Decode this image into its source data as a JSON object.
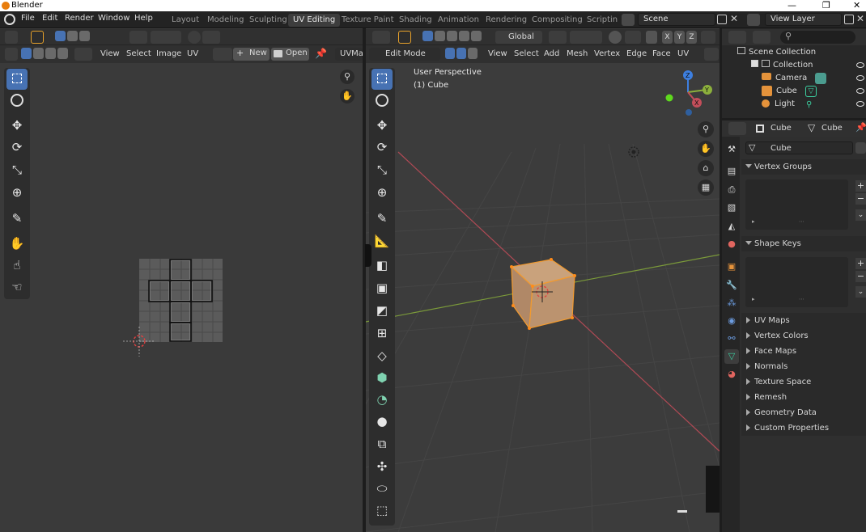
{
  "window": {
    "title": "Blender",
    "controls": [
      "—",
      "❐",
      "✕"
    ]
  },
  "menubar": {
    "items": [
      "File",
      "Edit",
      "Render",
      "Window",
      "Help"
    ]
  },
  "workspaces": {
    "tabs": [
      "Layout",
      "Modeling",
      "Sculpting",
      "UV Editing",
      "Texture Paint",
      "Shading",
      "Animation",
      "Rendering",
      "Compositing",
      "Scriptin"
    ],
    "active": "UV Editing"
  },
  "scene": {
    "name": "Scene"
  },
  "view_layer": {
    "name": "View Layer"
  },
  "uv_editor": {
    "menus": [
      "View",
      "Select",
      "Image",
      "UV"
    ],
    "new_label": "New",
    "open_label": "Open",
    "uvmap_label": "UVMap"
  },
  "viewport": {
    "orientation": "Global",
    "mode": "Edit Mode",
    "menus": [
      "View",
      "Select",
      "Add",
      "Mesh",
      "Vertex",
      "Edge",
      "Face",
      "UV"
    ],
    "info_line1": "User Perspective",
    "info_line2": "(1) Cube",
    "axis_letters": [
      "X",
      "Y",
      "Z"
    ],
    "gizmo_labels": {
      "x": "X",
      "y": "Y",
      "z": "Z"
    }
  },
  "outliner": {
    "root": "Scene Collection",
    "collection": "Collection",
    "objects": [
      "Camera",
      "Cube",
      "Light"
    ]
  },
  "properties": {
    "object_name": "Cube",
    "mesh_name": "Cube",
    "data_field": "Cube",
    "open_panels": [
      "Vertex Groups",
      "Shape Keys"
    ],
    "closed_panels": [
      "UV Maps",
      "Vertex Colors",
      "Face Maps",
      "Normals",
      "Texture Space",
      "Remesh",
      "Geometry Data",
      "Custom Properties"
    ]
  },
  "colors": {
    "accent": "#4772b3",
    "x_axis": "#c34e5a",
    "y_axis": "#8cb03c",
    "z_axis": "#3d7fe0",
    "selection": "#ff9c2a"
  }
}
